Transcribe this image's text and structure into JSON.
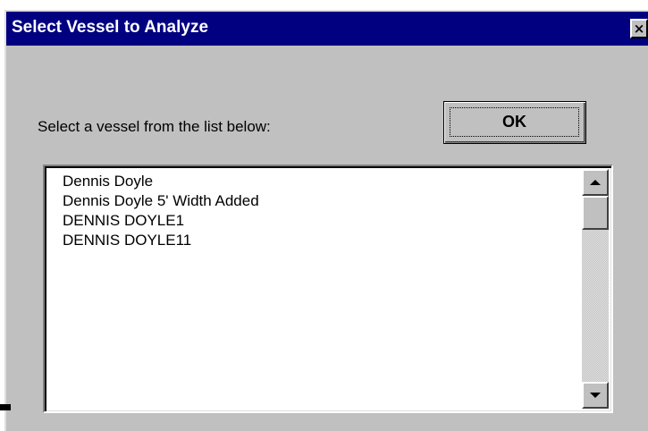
{
  "window": {
    "title": "Select Vessel to Analyze",
    "close_label": "×"
  },
  "dialog": {
    "prompt": "Select a vessel from the list below:",
    "ok_label": "OK"
  },
  "vessel_list": {
    "items": [
      "Dennis Doyle",
      "Dennis Doyle 5' Width Added",
      "DENNIS DOYLE1",
      "DENNIS DOYLE11"
    ]
  },
  "colors": {
    "titlebar": "#000080",
    "face": "#c0c0c0",
    "list_background": "#ffffff"
  },
  "icons": {
    "close": "close-icon",
    "scroll_up": "scroll-up-arrow-icon",
    "scroll_down": "scroll-down-arrow-icon"
  }
}
